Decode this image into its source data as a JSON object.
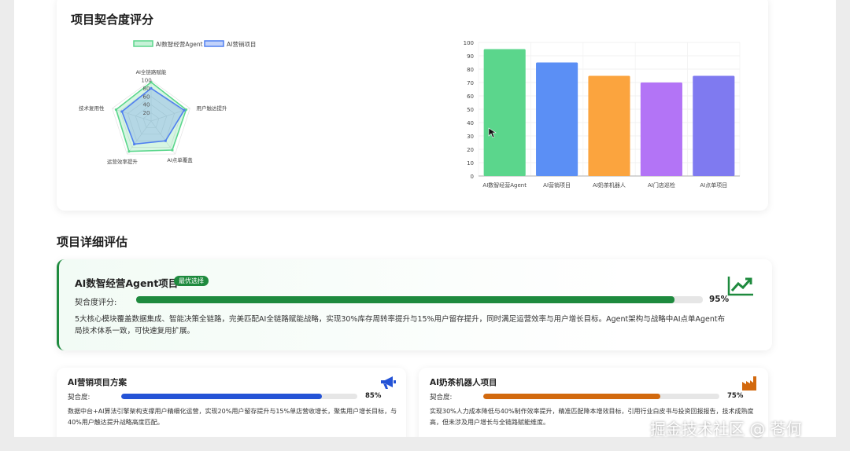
{
  "chart_section": {
    "title": "项目契合度评分"
  },
  "chart_data": [
    {
      "type": "radar",
      "legend": [
        "AI数智经营Agent",
        "AI营销项目"
      ],
      "legend_position": "top-left",
      "axes": [
        "AI全链路赋能",
        "用户触达提升",
        "AI点单覆盖",
        "运营效率提升",
        "技术复用性"
      ],
      "ticks": [
        "20",
        "40",
        "60",
        "80",
        "100"
      ],
      "range": [
        0,
        100
      ],
      "series": [
        {
          "name": "AI数智经营Agent",
          "values": [
            95,
            90,
            88,
            92,
            90
          ],
          "color": "#5bd68c"
        },
        {
          "name": "AI营销项目",
          "values": [
            80,
            85,
            60,
            70,
            75
          ],
          "color": "#4f7ff0"
        }
      ]
    },
    {
      "type": "bar",
      "categories": [
        "AI数智经营Agent",
        "AI营销项目",
        "AI奶茶机器人",
        "AI门店巡检",
        "AI点单项目"
      ],
      "values": [
        95,
        85,
        75,
        70,
        75
      ],
      "colors": [
        "#5bd68c",
        "#5b8ff5",
        "#fba43e",
        "#b374f6",
        "#7f7af0"
      ],
      "ylim": [
        0,
        100
      ],
      "yticks": [
        "0",
        "10",
        "20",
        "30",
        "40",
        "50",
        "60",
        "70",
        "80",
        "90",
        "100"
      ],
      "grid": true
    }
  ],
  "detail_section": {
    "title": "项目详细评估"
  },
  "featured": {
    "name": "AI数智经营Agent项目",
    "badge": "最优选择",
    "score_label": "契合度评分:",
    "score": 95,
    "score_text": "95%",
    "color": "#1e8a3e",
    "icon": "trend-up-icon",
    "description": "5大核心模块覆盖数据集成、智能决策全链路，完美匹配AI全链路赋能战略，实现30%库存周转率提升与15%用户留存提升，同时满足运营效率与用户增长目标。Agent架构与战略中AI点单Agent布局技术体系一致，可快速复用扩展。"
  },
  "projects": [
    {
      "name": "AI营销项目方案",
      "score_label": "契合度:",
      "score": 85,
      "score_text": "85%",
      "color": "#2453d6",
      "icon": "megaphone-icon",
      "description": "数据中台+AI算法引擎架构支撑用户精细化运营，实现20%用户留存提升与15%单店营收增长，聚焦用户增长目标，与40%用户触达提升战略高度匹配。"
    },
    {
      "name": "AI奶茶机器人项目",
      "score_label": "契合度:",
      "score": 75,
      "score_text": "75%",
      "color": "#d2690e",
      "icon": "factory-icon",
      "description": "实现30%人力成本降低与40%制作效率提升，精准匹配降本增效目标，引用行业白皮书与投资回报报告，技术成熟度高，但未涉及用户增长与全链路赋能维度。"
    }
  ],
  "watermark": "掘金技术社区 @ 苍何"
}
